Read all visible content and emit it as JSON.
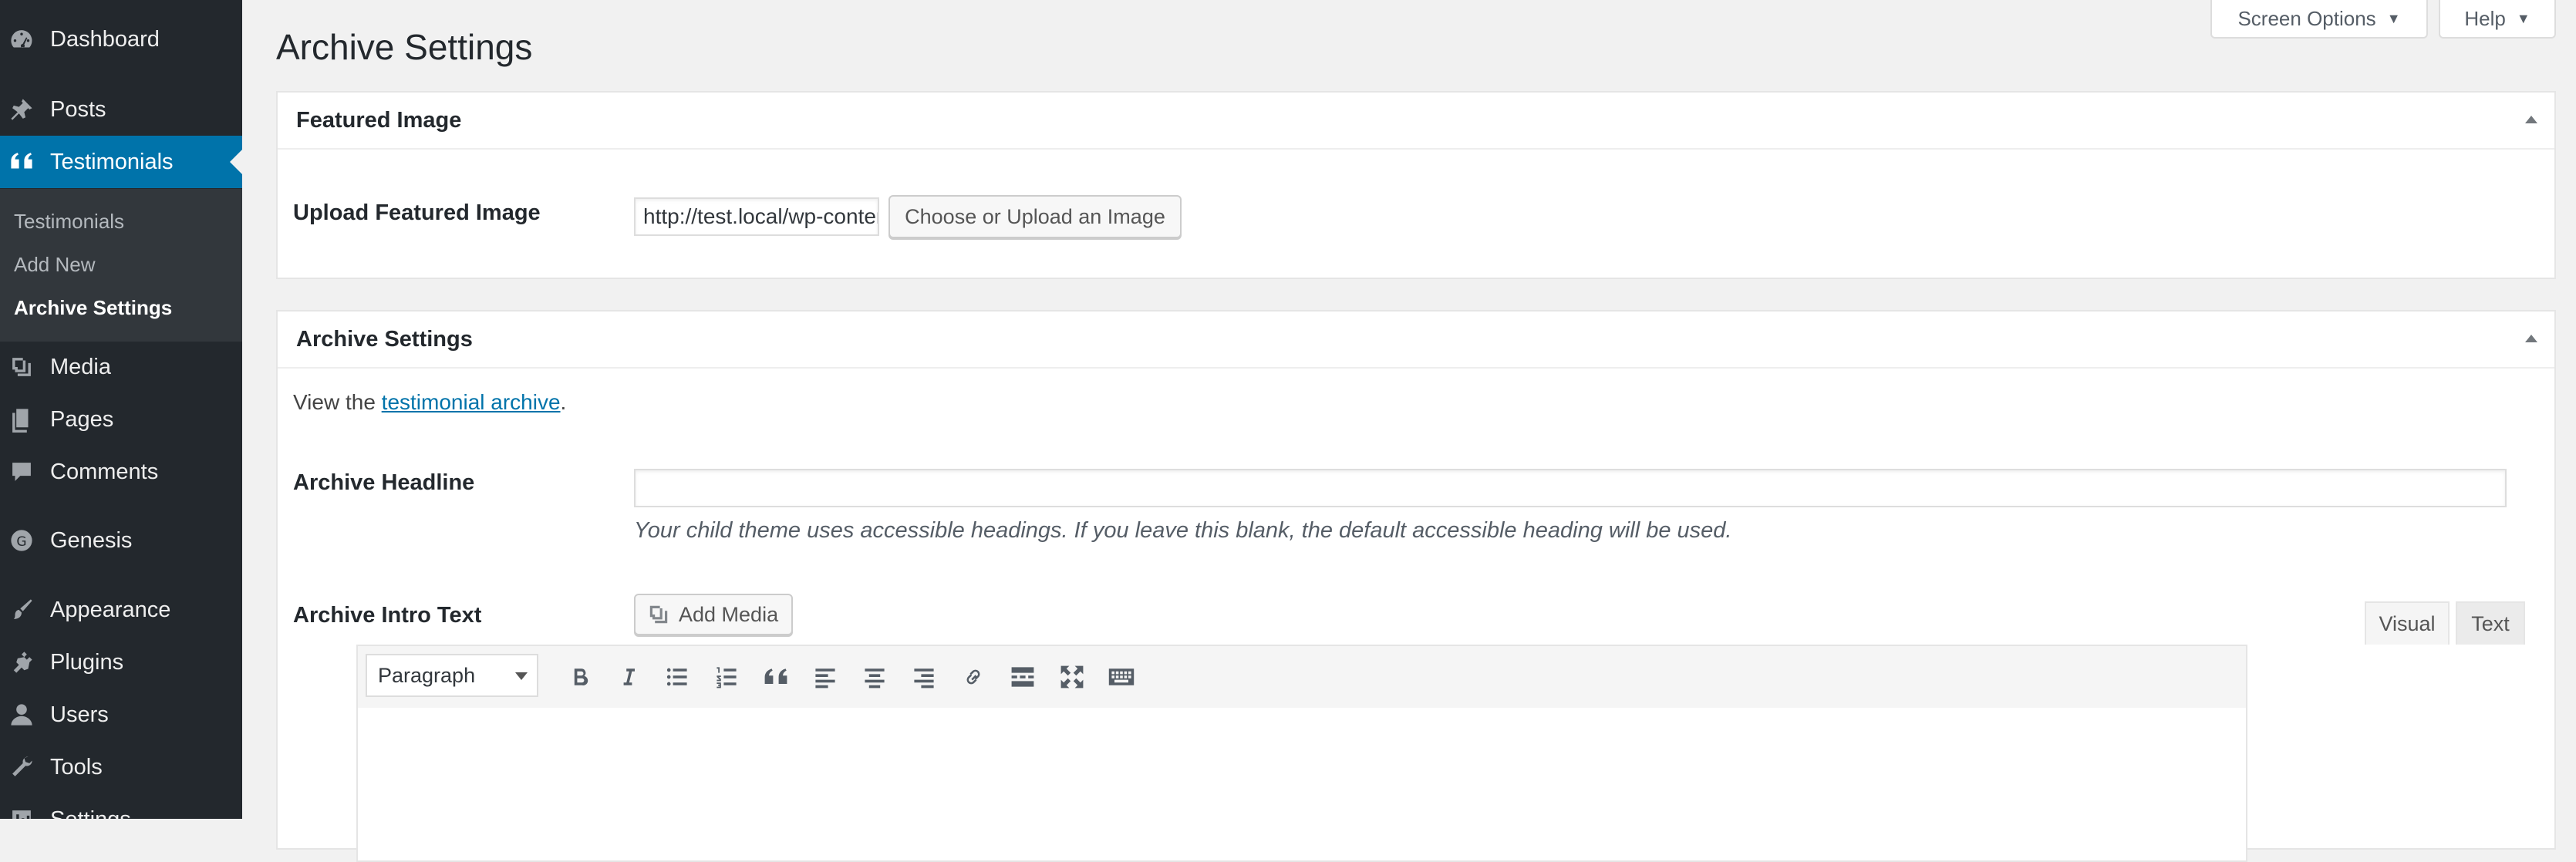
{
  "sidebar": {
    "items": [
      {
        "label": "Dashboard",
        "icon": "dashboard-icon"
      },
      {
        "label": "Posts",
        "icon": "pin-icon"
      },
      {
        "label": "Testimonials",
        "icon": "quote-icon"
      },
      {
        "label": "Media",
        "icon": "media-icon"
      },
      {
        "label": "Pages",
        "icon": "pages-icon"
      },
      {
        "label": "Comments",
        "icon": "comment-icon"
      },
      {
        "label": "Genesis",
        "icon": "genesis-icon"
      },
      {
        "label": "Appearance",
        "icon": "brush-icon"
      },
      {
        "label": "Plugins",
        "icon": "plugin-icon"
      },
      {
        "label": "Users",
        "icon": "user-icon"
      },
      {
        "label": "Tools",
        "icon": "wrench-icon"
      },
      {
        "label": "Settings",
        "icon": "settings-icon"
      }
    ],
    "submenu": [
      "Testimonials",
      "Add New",
      "Archive Settings"
    ],
    "active_color": "#0073aa"
  },
  "header": {
    "screen_options": "Screen Options",
    "help": "Help",
    "title": "Archive Settings"
  },
  "featured_image": {
    "title": "Featured Image",
    "label": "Upload Featured Image",
    "url_value": "http://test.local/wp-content/uploads/",
    "button": "Choose or Upload an Image"
  },
  "archive": {
    "title": "Archive Settings",
    "view_prefix": "View the ",
    "view_link": "testimonial archive",
    "view_suffix": ".",
    "headline_label": "Archive Headline",
    "headline_value": "",
    "headline_desc": "Your child theme uses accessible headings. If you leave this blank, the default accessible heading will be used.",
    "intro_label": "Archive Intro Text",
    "add_media": "Add Media",
    "tab_visual": "Visual",
    "tab_text": "Text",
    "format": "Paragraph",
    "toolbar": [
      "bold-icon",
      "italic-icon",
      "bulleted-list-icon",
      "numbered-list-icon",
      "blockquote-icon",
      "align-left-icon",
      "align-center-icon",
      "align-right-icon",
      "link-icon",
      "read-more-icon",
      "fullscreen-icon",
      "toolbar-toggle-icon"
    ]
  }
}
